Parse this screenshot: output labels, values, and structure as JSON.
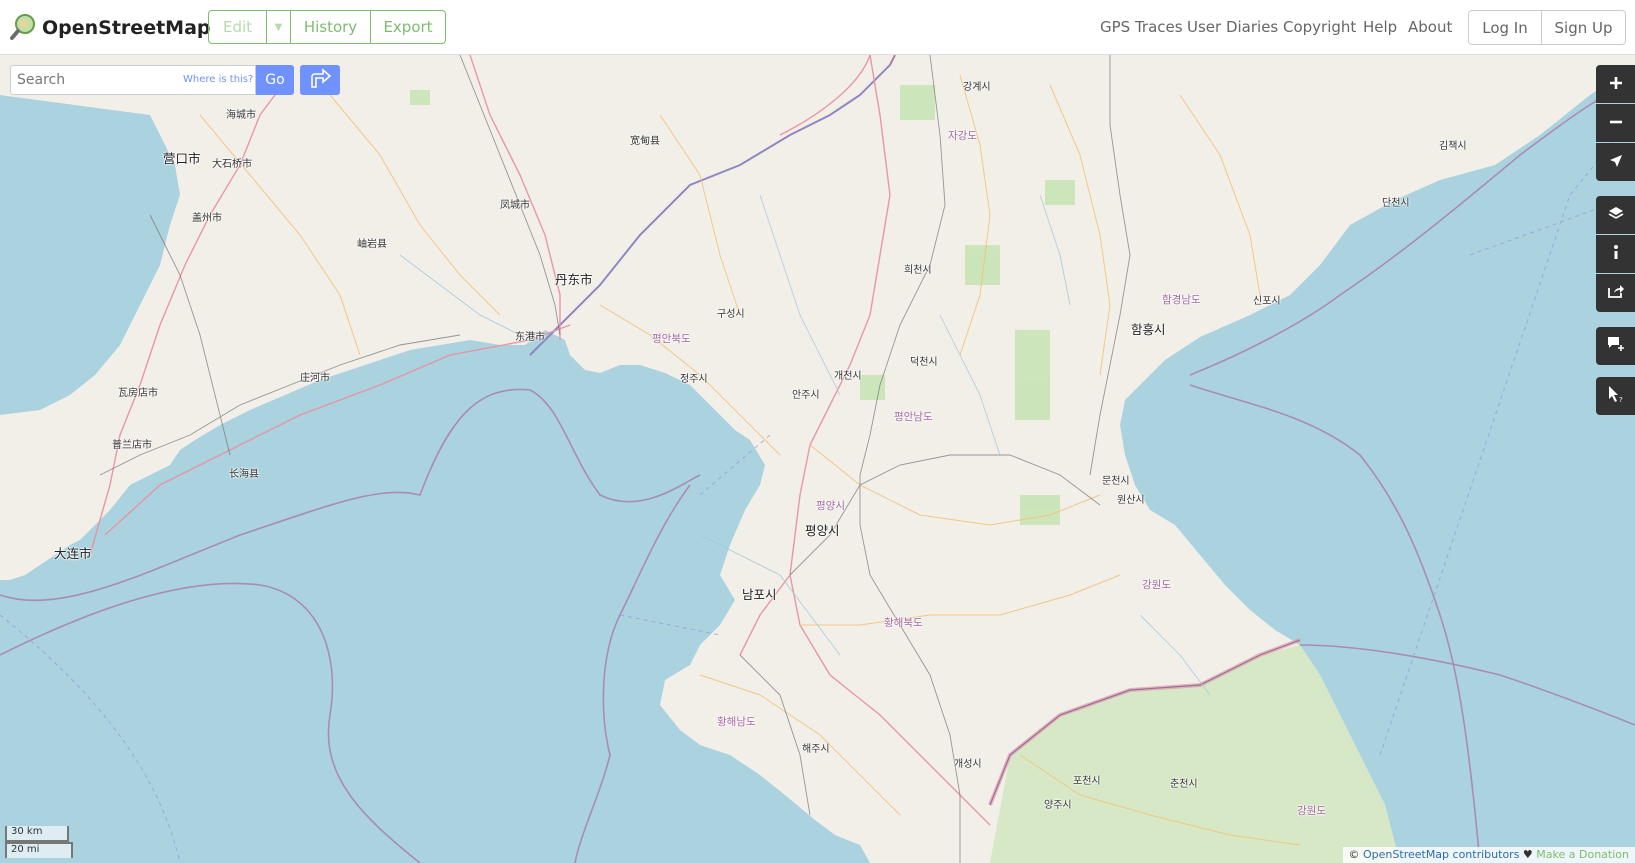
{
  "header": {
    "brand": "OpenStreetMap",
    "edit_label": "Edit",
    "history_label": "History",
    "export_label": "Export",
    "nav": [
      "GPS Traces",
      "User Diaries",
      "Copyright",
      "Help",
      "About"
    ],
    "login_label": "Log In",
    "signup_label": "Sign Up"
  },
  "search": {
    "placeholder": "Search",
    "where_is_this": "Where is this?",
    "go_label": "Go"
  },
  "map_controls": [
    "zoom-in",
    "zoom-out",
    "show-my-location",
    "layers",
    "map-key",
    "share",
    "add-note",
    "query-features"
  ],
  "map_labels": {
    "cities_major": [
      "营口市",
      "丹东市",
      "大连市",
      "평양시",
      "남포시",
      "함흥시"
    ],
    "cities_minor": [
      "海城市",
      "大石桥市",
      "盖州市",
      "岫岩县",
      "宽甸县",
      "凤城市",
      "东港市",
      "庄河市",
      "瓦房店市",
      "普兰店市",
      "长海县",
      "구성시",
      "정주시",
      "안주시",
      "개천시",
      "덕천시",
      "희천시",
      "강계시",
      "김책시",
      "단천시",
      "신포시",
      "문천시",
      "원산시",
      "해주시",
      "개성시",
      "포천시",
      "춘천시",
      "양주시"
    ],
    "provinces": [
      "자강도",
      "평안북도",
      "평안남도",
      "평양시",
      "함경남도",
      "강원도",
      "황해북도",
      "황해남도",
      "강원도"
    ]
  },
  "scale": {
    "metric": "30 km",
    "imperial": "20 mi"
  },
  "attribution": {
    "prefix": "©",
    "contributors": "OpenStreetMap contributors",
    "heart": "♥",
    "donate": "Make a Donation"
  },
  "colors": {
    "brand_green": "#7ebc6f",
    "search_blue": "#7092ff",
    "sea": "#aad3df",
    "land": "#f2efe9",
    "forest": "#c8e3b6",
    "border": "#a3689e"
  }
}
